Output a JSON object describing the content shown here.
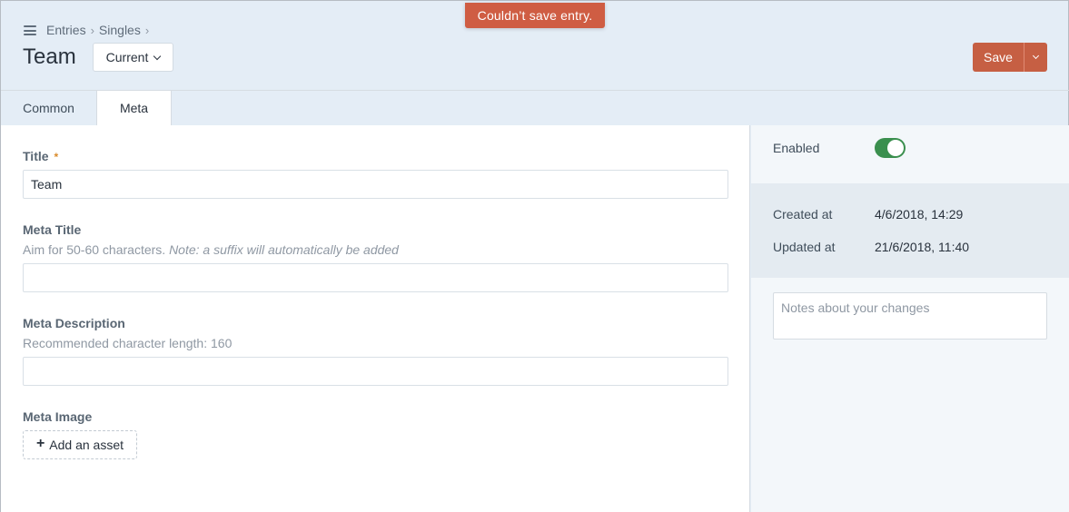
{
  "notification": {
    "text": "Couldn’t save entry."
  },
  "header": {
    "breadcrumbs": [
      "Entries",
      "Singles"
    ],
    "title": "Team",
    "site_menu_label": "Current",
    "save_label": "Save"
  },
  "tabs": [
    {
      "label": "Common",
      "active": false
    },
    {
      "label": "Meta",
      "active": true
    }
  ],
  "fields": {
    "title": {
      "label": "Title",
      "required_mark": "*",
      "value": "Team"
    },
    "meta_title": {
      "label": "Meta Title",
      "instructions": "Aim for 50-60 characters.",
      "instructions_note": "Note: a suffix will automatically be added",
      "value": ""
    },
    "meta_description": {
      "label": "Meta Description",
      "instructions": "Recommended character length: 160",
      "value": ""
    },
    "meta_image": {
      "label": "Meta Image",
      "button_label": "Add an asset"
    }
  },
  "sidebar": {
    "enabled_label": "Enabled",
    "enabled": true,
    "created_label": "Created at",
    "created_value": "4/6/2018, 14:29",
    "updated_label": "Updated at",
    "updated_value": "21/6/2018, 11:40",
    "notes_placeholder": "Notes about your changes"
  },
  "colors": {
    "accent": "#c65f43",
    "notice": "#cf5d43",
    "toggle_on": "#3a8f4e",
    "header_bg": "#e4edf6"
  }
}
